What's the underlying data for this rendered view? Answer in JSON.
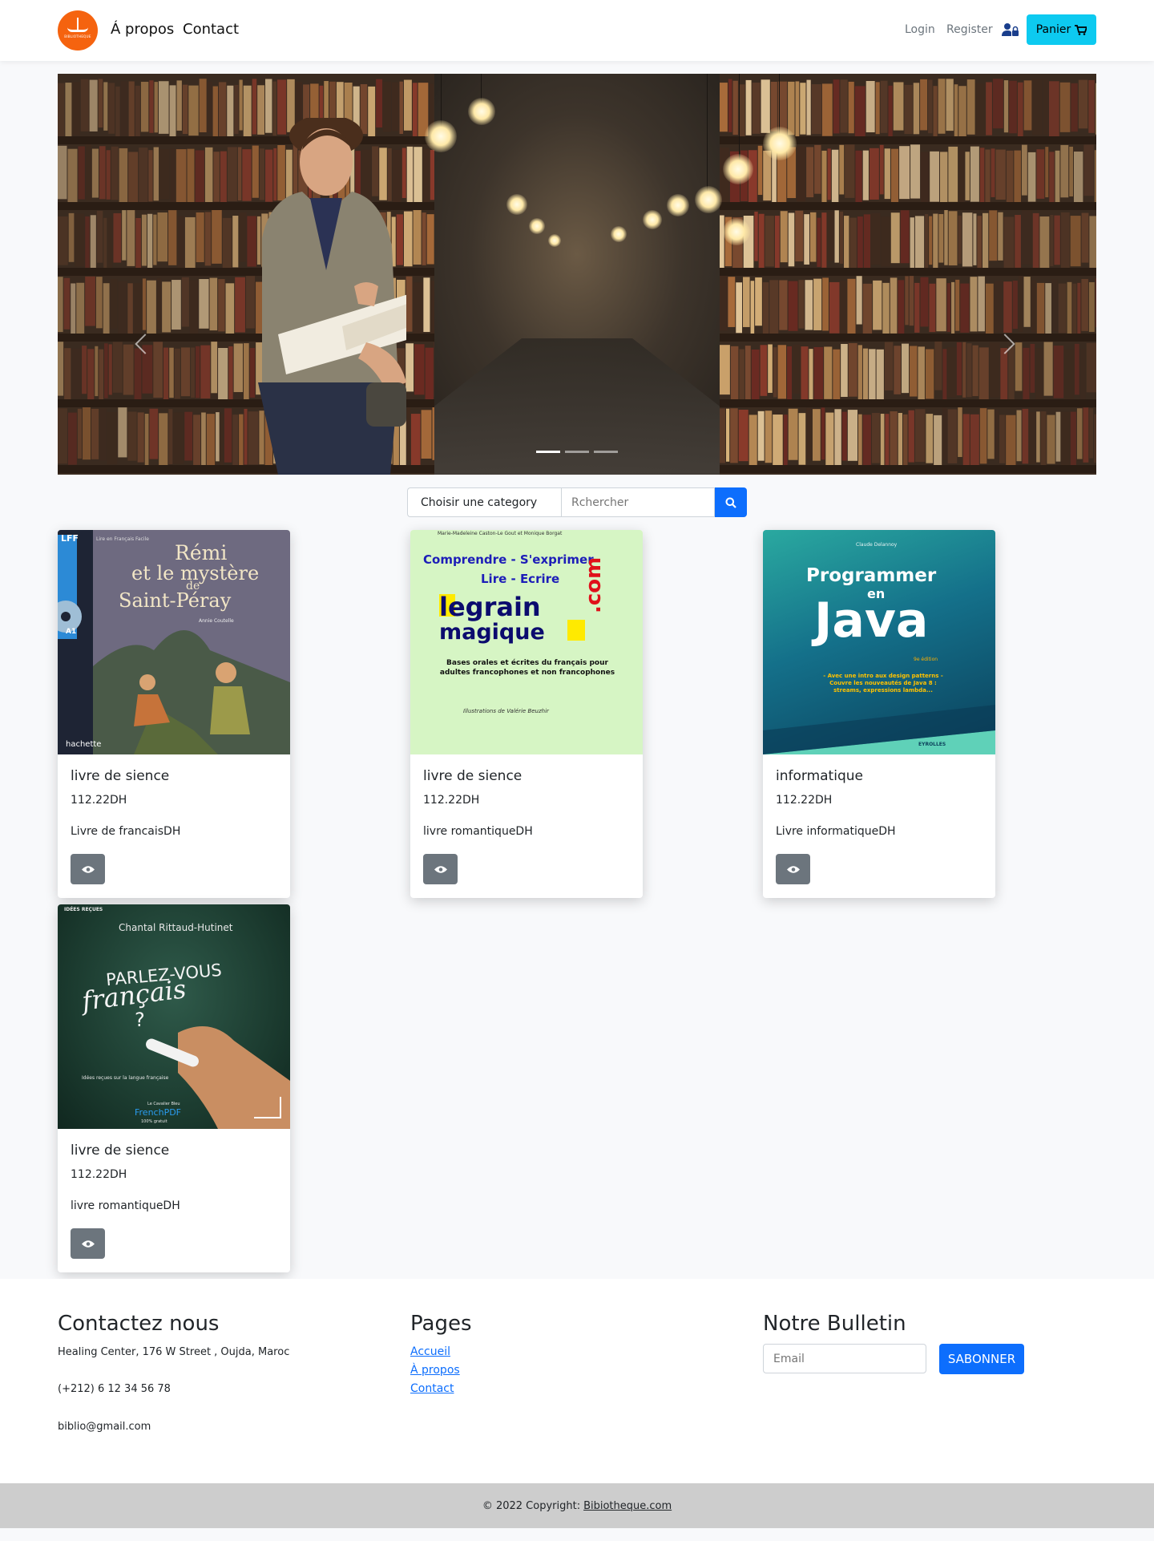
{
  "nav": {
    "logo_text": "BIBLIOTHEQUE",
    "links": [
      "Á propos",
      "Contact"
    ],
    "login": "Login",
    "register": "Register",
    "cart_label": "Panier"
  },
  "search": {
    "category_label": "Choisir une category",
    "placeholder": "Rchercher"
  },
  "books": [
    {
      "title": "livre de sience",
      "price": "112.22DH",
      "description": "Livre de francaisDH",
      "cover": {
        "title_lines": [
          "Rémi",
          "et le mystère",
          "de",
          "Saint-Péray"
        ],
        "series": "LFF",
        "level": "A1",
        "publisher": "hachette",
        "top_text": "Lire en Français Facile",
        "author": "Annie Coutelle"
      }
    },
    {
      "title": "livre de sience",
      "price": "112.22DH",
      "description": "livre romantiqueDH",
      "cover": {
        "authors": "Marie-Madeleine Caston-Le Gout et Monique Borgat",
        "line1": "Comprendre - S'exprimer",
        "line2": "Lire - Ecrire",
        "brand1": "legrain",
        "brand2": "magique",
        "dotcom": ".com",
        "subtitle": "Bases orales et écrites du français pour adultes francophones et non francophones",
        "illustrator": "Illustrations de Valérie Beuzhir"
      }
    },
    {
      "title": "informatique",
      "price": "112.22DH",
      "description": "Livre informatiqueDH",
      "cover": {
        "author": "Claude Delannoy",
        "line1": "Programmer",
        "line2": "en",
        "line3": "Java",
        "edition": "9e édition",
        "tagline": "- Avec une intro aux design patterns - Couvre les nouveautés de Java 8 : streams, expressions lambda...",
        "publisher": "EYROLLES"
      }
    },
    {
      "title": "livre de sience",
      "price": "112.22DH",
      "description": "livre romantiqueDH",
      "cover": {
        "author": "Chantal Rittaud-Hutinet",
        "series": "IDÉES REÇUES",
        "line1": "PARLEZ-VOUS",
        "line2": "français",
        "line3": "?",
        "subtitle": "Idées reçues sur la langue française",
        "source": "FrenchPDF",
        "source_sub": "100% gratuit",
        "collection": "Le Cavalier Bleu"
      }
    }
  ],
  "footer": {
    "contact_heading": "Contactez nous",
    "address": "Healing Center, 176 W Street , Oujda, Maroc",
    "phone": "(+212) 6 12 34 56 78",
    "email": "biblio@gmail.com",
    "pages_heading": "Pages",
    "pages": [
      "Accueil",
      "À propos",
      "Contact"
    ],
    "bulletin_heading": "Notre Bulletin",
    "email_placeholder": "Email",
    "subscribe_label": "SABONNER"
  },
  "copyright": {
    "text": "© 2022 Copyright:",
    "link": "Bibiotheque.com"
  },
  "colors": {
    "accent": "#0d6efd",
    "cart": "#0dcaf0",
    "logo": "#f5630f",
    "view_button": "#6c757d"
  }
}
